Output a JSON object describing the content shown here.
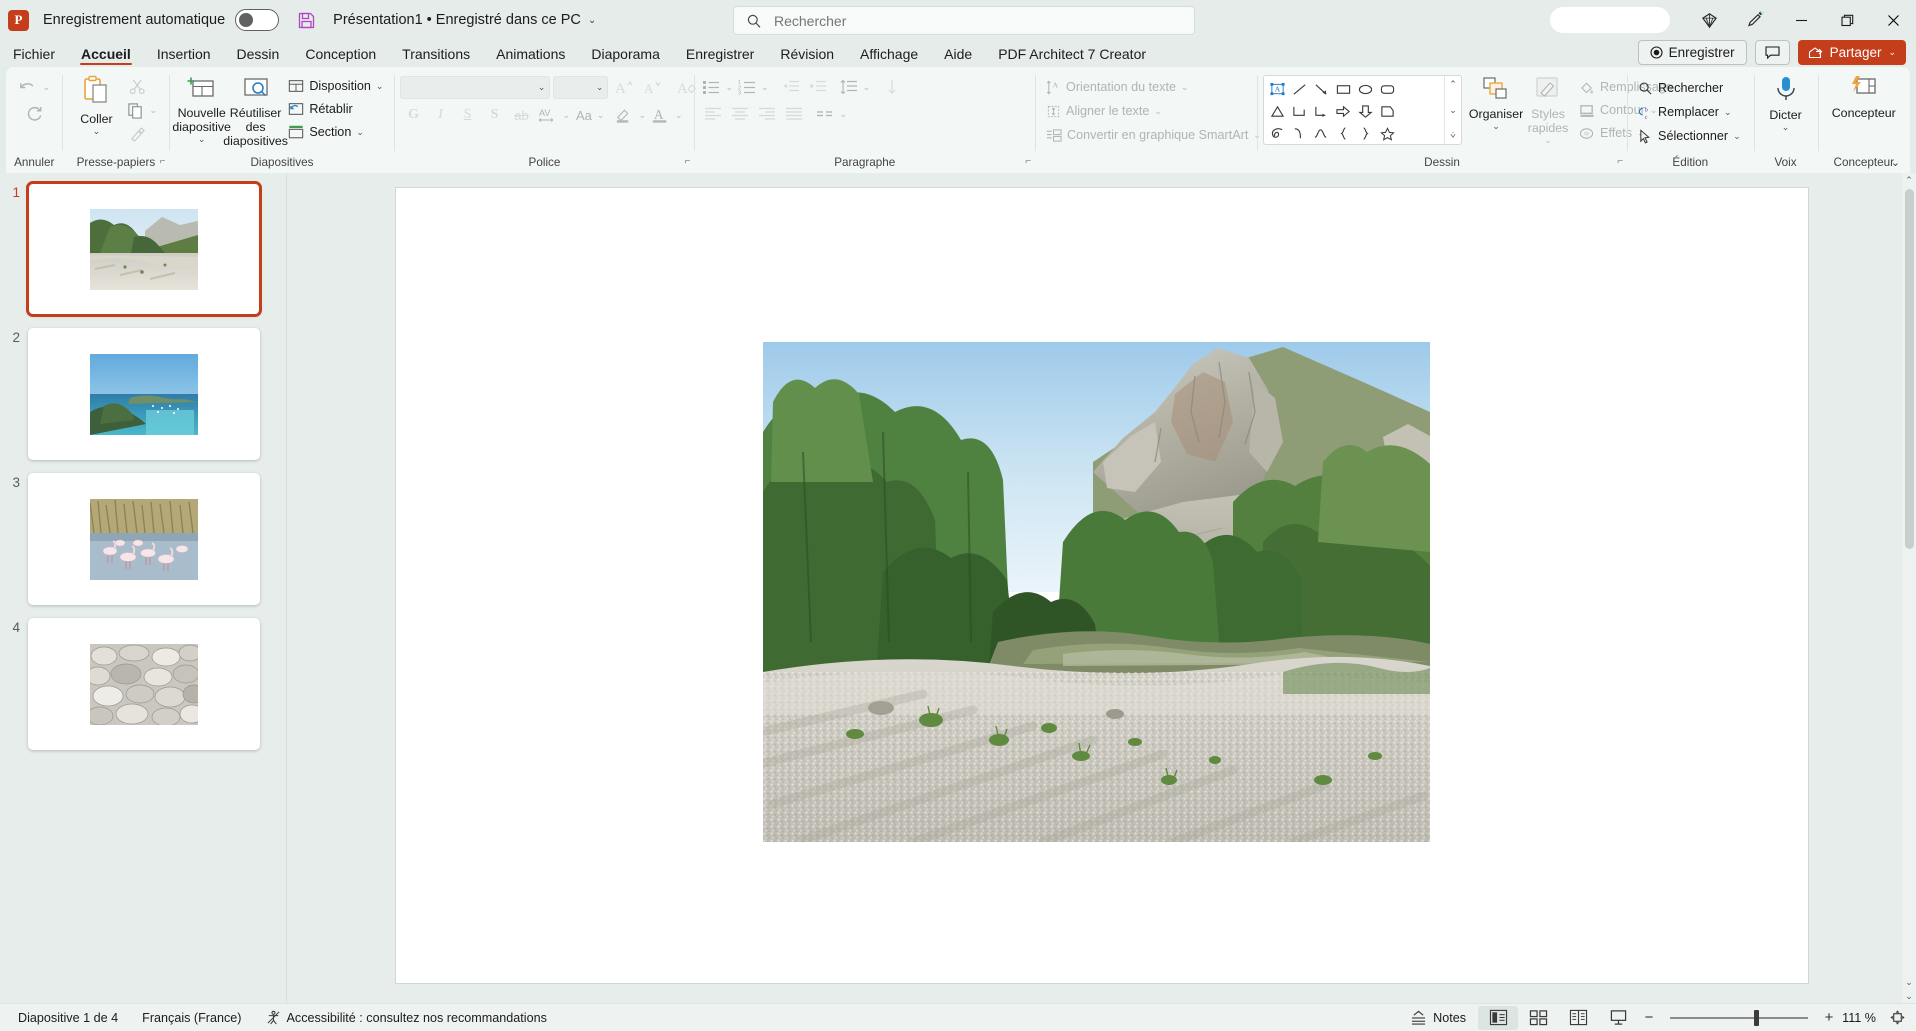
{
  "titlebar": {
    "logo_text": "P",
    "autosave_label": "Enregistrement automatique",
    "autosave_state": "off",
    "save_icon": "save-floppy-icon",
    "document_title": "Présentation1  •  Enregistré dans ce PC",
    "search_placeholder": "Rechercher",
    "search_value": "",
    "window_buttons": [
      "minimize",
      "restore",
      "close"
    ],
    "diamond_icon": "diamond-icon",
    "pen_icon": "pen-edit-icon"
  },
  "tabs": [
    {
      "label": "Fichier",
      "active": false
    },
    {
      "label": "Accueil",
      "active": true
    },
    {
      "label": "Insertion",
      "active": false
    },
    {
      "label": "Dessin",
      "active": false
    },
    {
      "label": "Conception",
      "active": false
    },
    {
      "label": "Transitions",
      "active": false
    },
    {
      "label": "Animations",
      "active": false
    },
    {
      "label": "Diaporama",
      "active": false
    },
    {
      "label": "Enregistrer",
      "active": false
    },
    {
      "label": "Révision",
      "active": false
    },
    {
      "label": "Affichage",
      "active": false
    },
    {
      "label": "Aide",
      "active": false
    },
    {
      "label": "PDF Architect 7 Creator",
      "active": false
    }
  ],
  "tabbar_right": {
    "save_button": "Enregistrer",
    "comments_button": "comment-icon",
    "share_button": "Partager"
  },
  "ribbon": {
    "collapse_icon": "chevron-up-icon",
    "groups": [
      {
        "name": "Annuler",
        "title": "Annuler",
        "items": [
          {
            "label": "Annuler",
            "icon": "undo-arrow-icon",
            "disabled": true,
            "has_dropdown": true
          },
          {
            "label": "Rétablir",
            "icon": "redo-circle-icon",
            "disabled": true,
            "has_dropdown": false
          }
        ]
      },
      {
        "name": "Presse-papiers",
        "title": "Presse-papiers",
        "dialog_launcher": true,
        "items": [
          {
            "label": "Coller",
            "icon": "paste-clipboard-icon",
            "disabled": false,
            "has_dropdown": true
          },
          {
            "label": "Couper",
            "icon": "scissors-icon",
            "disabled": true,
            "has_dropdown": false
          },
          {
            "label": "Copier",
            "icon": "copy-icon",
            "disabled": true,
            "has_dropdown": true
          },
          {
            "label": "Reproduire la mise en forme",
            "icon": "format-painter-icon",
            "disabled": true,
            "has_dropdown": false
          }
        ]
      },
      {
        "name": "Diapositives",
        "title": "Diapositives",
        "items": [
          {
            "label": "Nouvelle diapositive",
            "icon": "new-slide-icon",
            "disabled": false,
            "has_dropdown": true
          },
          {
            "label": "Réutiliser des diapositives",
            "icon": "reuse-slides-icon",
            "disabled": false,
            "has_dropdown": false
          },
          {
            "label": "Disposition",
            "icon": "layout-icon",
            "disabled": false,
            "has_dropdown": true
          },
          {
            "label": "Rétablir",
            "icon": "reset-slide-icon",
            "disabled": false,
            "has_dropdown": false
          },
          {
            "label": "Section",
            "icon": "section-icon",
            "disabled": false,
            "has_dropdown": true
          }
        ]
      },
      {
        "name": "Police",
        "title": "Police",
        "dialog_launcher": true,
        "font_name": "",
        "font_size": "",
        "items": [
          {
            "label": "Agrandir la police",
            "icon": "grow-font-icon",
            "disabled": true
          },
          {
            "label": "Réduire la police",
            "icon": "shrink-font-icon",
            "disabled": true
          },
          {
            "label": "Effacer toute la mise en forme",
            "icon": "clear-format-icon",
            "disabled": true
          },
          {
            "label": "Gras",
            "icon": "bold-G-icon",
            "disabled": true
          },
          {
            "label": "Italique",
            "icon": "italic-I-icon",
            "disabled": true
          },
          {
            "label": "Souligné",
            "icon": "underline-S-icon",
            "disabled": true
          },
          {
            "label": "Ombre",
            "icon": "shadow-S-icon",
            "disabled": true
          },
          {
            "label": "Barré",
            "icon": "strikethrough-icon",
            "disabled": true
          },
          {
            "label": "Espacement des caractères",
            "icon": "char-spacing-AV-icon",
            "disabled": true
          },
          {
            "label": "Modifier la casse",
            "icon": "change-case-Aa-icon",
            "disabled": true
          },
          {
            "label": "Couleur de surbrillance du texte",
            "icon": "highlight-pen-icon",
            "disabled": true
          },
          {
            "label": "Couleur de police",
            "icon": "font-color-A-icon",
            "disabled": true
          }
        ]
      },
      {
        "name": "Paragraphe",
        "title": "Paragraphe",
        "dialog_launcher": true,
        "items": [
          {
            "label": "Puces",
            "icon": "bullets-icon",
            "disabled": true
          },
          {
            "label": "Numérotation",
            "icon": "numbering-icon",
            "disabled": true
          },
          {
            "label": "Diminuer le retrait",
            "icon": "decrease-indent-icon",
            "disabled": true
          },
          {
            "label": "Augmenter le retrait",
            "icon": "increase-indent-icon",
            "disabled": true
          },
          {
            "label": "Interligne",
            "icon": "line-spacing-icon",
            "disabled": true
          },
          {
            "label": "Aligner à gauche",
            "icon": "align-left-icon",
            "disabled": true
          },
          {
            "label": "Centrer",
            "icon": "align-center-icon",
            "disabled": true
          },
          {
            "label": "Aligner à droite",
            "icon": "align-right-icon",
            "disabled": true
          },
          {
            "label": "Justifier",
            "icon": "align-justify-icon",
            "disabled": true
          },
          {
            "label": "Colonnes",
            "icon": "columns-icon",
            "disabled": true
          },
          {
            "label": "Orientation du texte",
            "icon": "text-direction-icon",
            "disabled": true,
            "has_dropdown": true
          },
          {
            "label": "Aligner le texte",
            "icon": "align-text-icon",
            "disabled": true,
            "has_dropdown": true
          },
          {
            "label": "Convertir en graphique SmartArt",
            "icon": "smartart-icon",
            "disabled": true,
            "has_dropdown": true
          }
        ]
      },
      {
        "name": "Dessin",
        "title": "Dessin",
        "dialog_launcher": true,
        "shapes": [
          "text-box",
          "line",
          "arrow",
          "rectangle",
          "ellipse",
          "rounded-rectangle",
          "triangle",
          "elbow-connector",
          "elbow-arrow-connector",
          "block-arrow-right",
          "block-arrow-down",
          "pentagon-tag",
          "scribble",
          "curve-arc",
          "wave-curve",
          "left-brace",
          "right-brace",
          "star"
        ],
        "items": [
          {
            "label": "Organiser",
            "icon": "arrange-icon",
            "disabled": false,
            "has_dropdown": true
          },
          {
            "label": "Styles rapides",
            "icon": "quick-styles-icon",
            "disabled": true,
            "has_dropdown": true
          },
          {
            "label": "Remplissage",
            "icon": "shape-fill-icon",
            "disabled": true,
            "has_dropdown": true
          },
          {
            "label": "Contour",
            "icon": "shape-outline-icon",
            "disabled": true,
            "has_dropdown": true
          },
          {
            "label": "Effets",
            "icon": "shape-effects-icon",
            "disabled": true,
            "has_dropdown": true
          }
        ]
      },
      {
        "name": "Édition",
        "title": "Édition",
        "items": [
          {
            "label": "Rechercher",
            "icon": "search-magnifier-icon",
            "disabled": false
          },
          {
            "label": "Remplacer",
            "icon": "replace-icon",
            "disabled": false,
            "has_dropdown": true
          },
          {
            "label": "Sélectionner",
            "icon": "select-cursor-icon",
            "disabled": false,
            "has_dropdown": true
          }
        ]
      },
      {
        "name": "Voix",
        "title": "Voix",
        "items": [
          {
            "label": "Dicter",
            "icon": "microphone-icon",
            "disabled": false,
            "has_dropdown": true
          }
        ]
      },
      {
        "name": "Concepteur",
        "title": "Concepteur",
        "items": [
          {
            "label": "Concepteur",
            "icon": "designer-icon",
            "disabled": false
          }
        ]
      }
    ]
  },
  "thumbnails": [
    {
      "number": "1",
      "active": true,
      "caption": "paysage de gorge avec falaise calcaire et lit de galets"
    },
    {
      "number": "2",
      "active": false,
      "caption": "baie de mer turquoise avec bateaux vue des hauteurs"
    },
    {
      "number": "3",
      "active": false,
      "caption": "flamants roses dans un étang de Camargue"
    },
    {
      "number": "4",
      "active": false,
      "caption": "gros plan de galets gris polis"
    }
  ],
  "slide": {
    "photo_caption": "Gorge avec falaise calcaire, arbres verts et large lit de galets blancs"
  },
  "status": {
    "slide_counter": "Diapositive 1 de 4",
    "language": "Français (France)",
    "accessibility": "Accessibilité : consultez nos recommandations",
    "notes_label": "Notes",
    "views": [
      {
        "name": "normal",
        "icon": "normal-view-icon",
        "active": true
      },
      {
        "name": "trieuse",
        "icon": "slide-sorter-icon",
        "active": false
      },
      {
        "name": "lecture",
        "icon": "reading-view-icon",
        "active": false
      },
      {
        "name": "diaporama",
        "icon": "slideshow-icon",
        "active": false
      }
    ],
    "zoom_out": "−",
    "zoom_in": "+",
    "zoom_level": "111 %",
    "fit_icon": "fit-to-window-icon"
  },
  "colors": {
    "accent": "#c43e1c",
    "ribbon_bg": "#f3f7f5",
    "chrome_bg": "#e5ecea",
    "canvas_bg": "#e6edea"
  }
}
